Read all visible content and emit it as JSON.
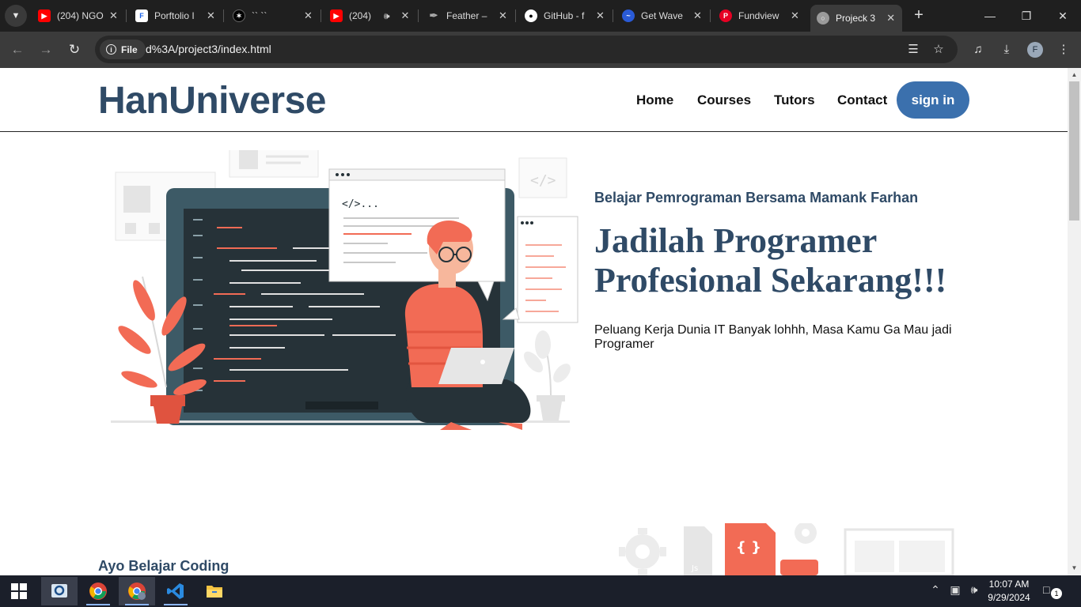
{
  "browser": {
    "tabs": [
      {
        "title": "(204) NGO",
        "icon": "youtube-icon"
      },
      {
        "title": "Porftolio I",
        "icon": "document-icon"
      },
      {
        "title": "`` ``",
        "icon": "app-icon"
      },
      {
        "title": "(204)",
        "icon": "youtube-icon",
        "audio": true
      },
      {
        "title": "Feather –",
        "icon": "feather-icon"
      },
      {
        "title": "GitHub - f",
        "icon": "github-icon"
      },
      {
        "title": "Get Wave",
        "icon": "wave-icon"
      },
      {
        "title": "Fundview",
        "icon": "pinterest-icon"
      },
      {
        "title": "Projeck 3",
        "icon": "globe-icon",
        "active": true
      }
    ],
    "address": {
      "scheme_label": "File",
      "url": "d%3A/project3/index.html"
    },
    "profile_initial": "F"
  },
  "site": {
    "logo": "HanUniverse",
    "nav": {
      "home": "Home",
      "courses": "Courses",
      "tutors": "Tutors",
      "contact": "Contact"
    },
    "signin_label": "sign in"
  },
  "hero": {
    "subtitle": "Belajar Pemrograman Bersama Mamank Farhan",
    "title": "Jadilah Programer Profesional Sekarang!!!",
    "description": "Peluang Kerja Dunia IT Banyak lohhh, Masa Kamu Ga Mau jadi Programer",
    "code_tag": "</>..."
  },
  "section2": {
    "title": "Ayo Belajar Coding",
    "file_badge": "{ }",
    "js_badge": "Js"
  },
  "taskbar": {
    "time": "10:07 AM",
    "date": "9/29/2024",
    "notification_count": "1"
  },
  "colors": {
    "brand": "#2f4a66",
    "button": "#3b70ad",
    "accent": "#f26b55"
  }
}
